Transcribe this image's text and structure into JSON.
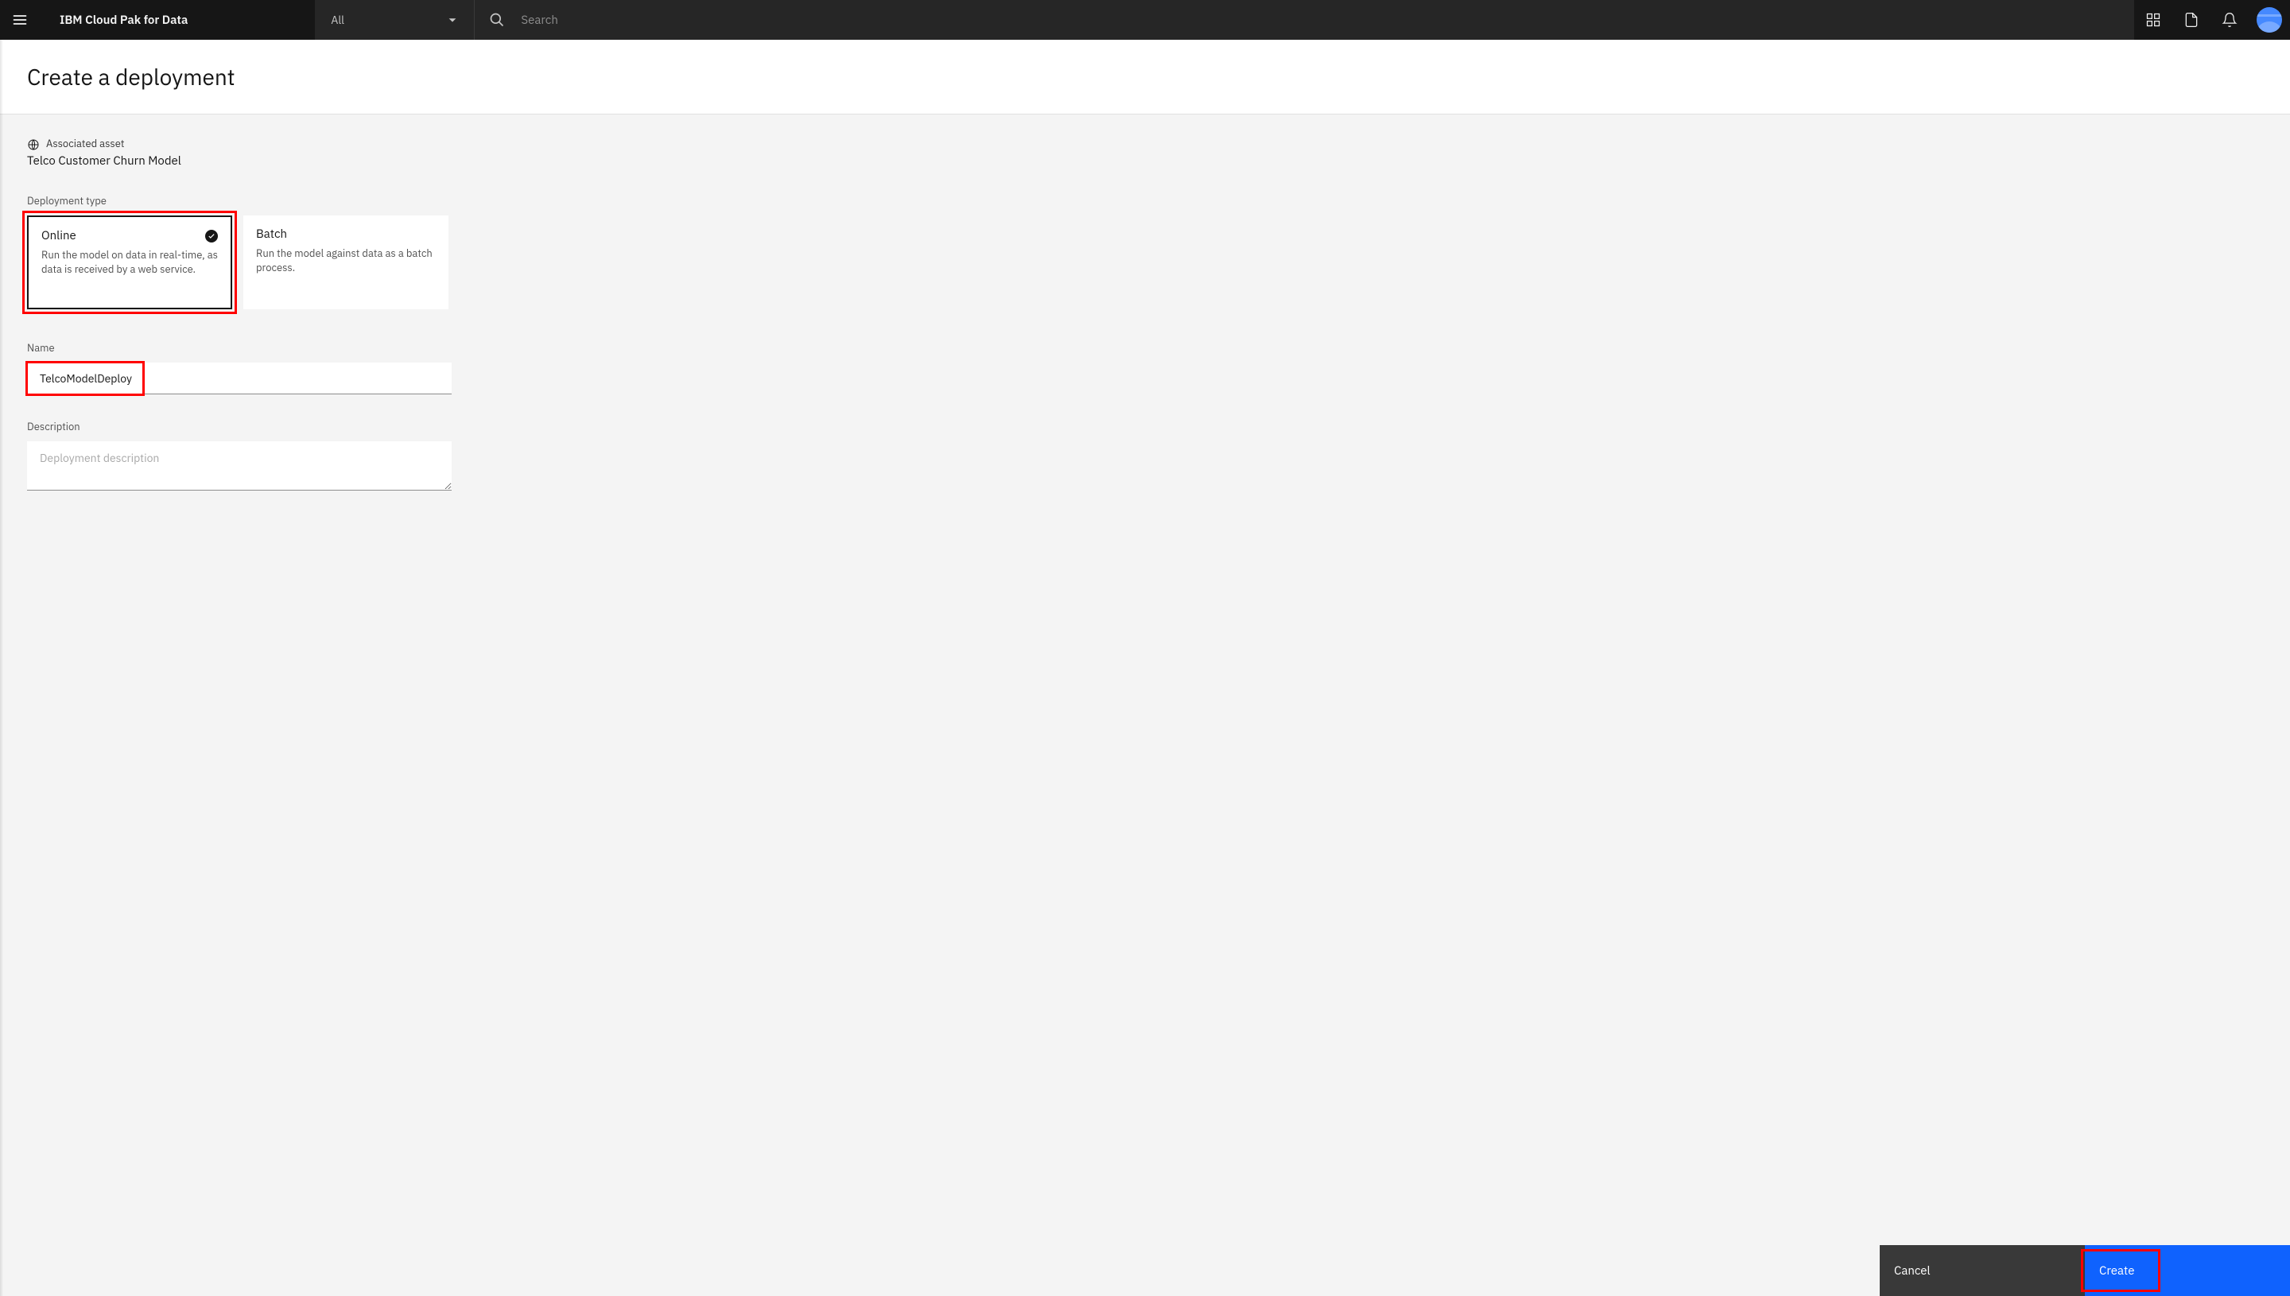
{
  "header": {
    "brand": "IBM Cloud Pak for Data",
    "filter_label": "All",
    "search_placeholder": "Search"
  },
  "page": {
    "title": "Create a deployment"
  },
  "asset": {
    "label": "Associated asset",
    "name": "Telco Customer Churn Model"
  },
  "deployment_type": {
    "label": "Deployment type",
    "options": [
      {
        "title": "Online",
        "description": "Run the model on data in real-time, as data is received by a web service.",
        "selected": true
      },
      {
        "title": "Batch",
        "description": "Run the model against data as a batch process.",
        "selected": false
      }
    ]
  },
  "name_field": {
    "label": "Name",
    "value": "TelcoModelDeploy"
  },
  "description_field": {
    "label": "Description",
    "placeholder": "Deployment description"
  },
  "footer": {
    "cancel": "Cancel",
    "create": "Create"
  }
}
